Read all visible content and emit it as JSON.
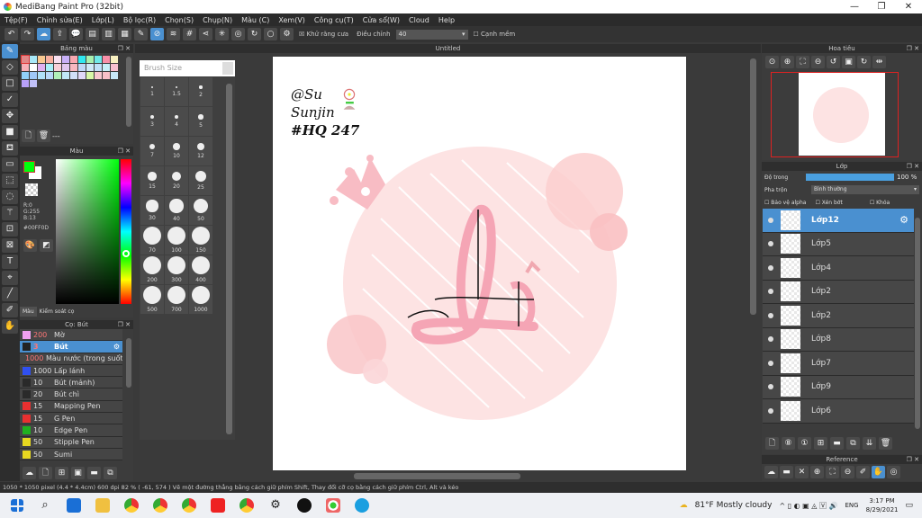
{
  "app": {
    "title": "MediBang Paint Pro (32bit)"
  },
  "menu": [
    "Tệp(F)",
    "Chỉnh sửa(E)",
    "Lớp(L)",
    "Bộ lọc(R)",
    "Chọn(S)",
    "Chụp(N)",
    "Màu (C)",
    "Xem(V)",
    "Công cụ(T)",
    "Cửa sổ(W)",
    "Cloud",
    "Help"
  ],
  "toolbar": {
    "antialias": "Khử răng cưa",
    "adjust_label": "Điều chỉnh",
    "adjust_value": "40",
    "edge": "Cạnh mềm"
  },
  "palette": {
    "title": "Bảng màu",
    "label": "---",
    "colors": [
      "#e08888",
      "#a8e8f8",
      "#f8c890",
      "#f8b0a0",
      "#f8e0f0",
      "#c8b0f8",
      "#f8a8b0",
      "#30e8f0",
      "#a8f0b0",
      "#70e8e8",
      "#f890a8",
      "#f8f0c0",
      "#f8b0b8",
      "#ffffff",
      "#e0b0f0",
      "#a8f0f8",
      "#f8d0d8",
      "#e0c8f0",
      "#f8b8c0",
      "#c0d8f8",
      "#d0e8f8",
      "#c0e0f8",
      "#c8f0f8",
      "#f8c0d0",
      "#90d0f8",
      "#a0c8f8",
      "#b0e0f8",
      "#b8d8f8",
      "#b0f0b8",
      "#c0e8f8",
      "#d0e0f8",
      "#e0d8f8",
      "#d8f8a8",
      "#f8c8d0",
      "#f8c0c8",
      "#c8e8f8",
      "#b8a0f8",
      "#c0c0f8"
    ]
  },
  "color_panel": {
    "title": "Màu",
    "r": "R:0",
    "g": "G:255",
    "b": "B:13",
    "hex": "#00FF0D",
    "fg": "#00ff0d",
    "tabs": [
      "Màu",
      "Kiểm soát cọ"
    ]
  },
  "brush_panel": {
    "title": "Cọ: Bút",
    "brushes": [
      {
        "size": "200",
        "name": "Mờ",
        "color": "#f0a0f0",
        "red": true
      },
      {
        "size": "3",
        "name": "Bút",
        "color": "#222222",
        "red": true,
        "selected": true
      },
      {
        "size": "1000",
        "name": "Màu nước (trong suốt)",
        "color": "#80e0f0",
        "red": true
      },
      {
        "size": "1000",
        "name": "Lấp lánh",
        "color": "#3050f0"
      },
      {
        "size": "10",
        "name": "Bút (mảnh)",
        "color": "#2a2a2a"
      },
      {
        "size": "20",
        "name": "Bút chì",
        "color": "#2a2a2a"
      },
      {
        "size": "15",
        "name": "Mapping Pen",
        "color": "#e83030"
      },
      {
        "size": "15",
        "name": "G Pen",
        "color": "#e83030"
      },
      {
        "size": "10",
        "name": "Edge Pen",
        "color": "#20b020"
      },
      {
        "size": "50",
        "name": "Stipple Pen",
        "color": "#e8d820"
      },
      {
        "size": "50",
        "name": "Sumi",
        "color": "#e8d820"
      }
    ]
  },
  "brush_size": {
    "title": "Brush Size",
    "sizes": [
      "1",
      "1.5",
      "2",
      "3",
      "4",
      "5",
      "7",
      "10",
      "12",
      "15",
      "20",
      "25",
      "30",
      "40",
      "50",
      "70",
      "100",
      "150",
      "200",
      "300",
      "400",
      "500",
      "700",
      "1000"
    ]
  },
  "document": {
    "tab": "Untitled",
    "art_text": [
      "@Su",
      "Sunjin",
      "#HQ 247",
      "Lê"
    ]
  },
  "navigator": {
    "title": "Hoa tiêu"
  },
  "layers": {
    "title": "Lớp",
    "opacity_label": "Độ trong",
    "opacity_value": "100 %",
    "opacity": 100,
    "blend_label": "Pha trộn",
    "blend_value": "Bình thường",
    "protect_alpha": "Bảo vệ alpha",
    "clipping": "Xén bớt",
    "lock": "Khóa",
    "items": [
      {
        "name": "Lớp12",
        "selected": true
      },
      {
        "name": "Lớp5"
      },
      {
        "name": "Lớp4"
      },
      {
        "name": "Lớp2"
      },
      {
        "name": "Lớp2"
      },
      {
        "name": "Lớp8"
      },
      {
        "name": "Lớp7"
      },
      {
        "name": "Lớp9"
      },
      {
        "name": "Lớp6"
      }
    ]
  },
  "reference": {
    "title": "Reference"
  },
  "status": {
    "text": "1050 * 1050 pixel   (4.4 * 4.4cm)   600 dpi   82 %   ( -61, 574 )   Vẽ một đường thẳng bằng cách giữ phím Shift, Thay đổi cỡ cọ bằng cách giữ phím Ctrl, Alt và kéo"
  },
  "taskbar": {
    "weather": "81°F  Mostly cloudy",
    "lang": "ENG",
    "time": "3:17 PM",
    "date": "8/29/2021"
  }
}
